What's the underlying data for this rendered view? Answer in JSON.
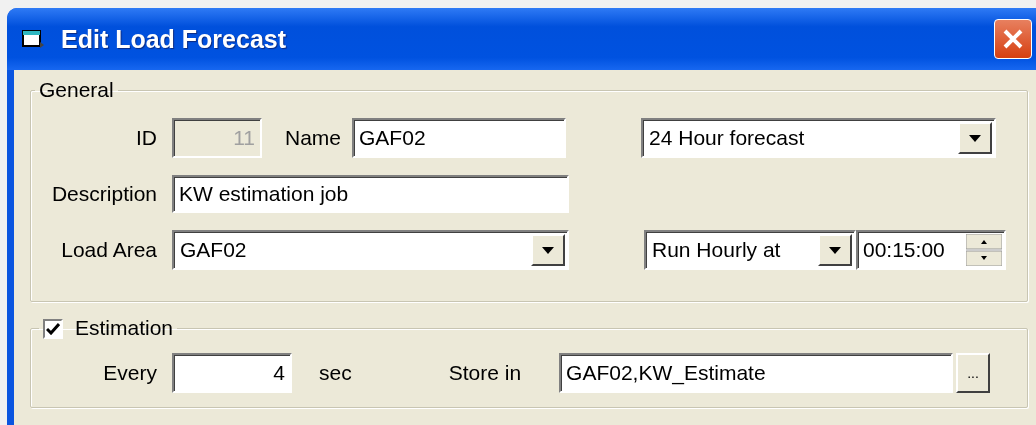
{
  "window": {
    "title": "Edit Load Forecast"
  },
  "general": {
    "legend": "General",
    "id": {
      "label": "ID",
      "value": "11",
      "disabled": true
    },
    "name": {
      "label": "Name",
      "value": "GAF02"
    },
    "forecast_type": {
      "value": "24 Hour forecast"
    },
    "description": {
      "label": "Description",
      "value": "KW estimation job"
    },
    "load_area": {
      "label": "Load Area",
      "value": "GAF02"
    },
    "schedule": {
      "value": "Run Hourly at"
    },
    "time": {
      "value": "00:15:00"
    }
  },
  "estimation": {
    "label": "Estimation",
    "checked": true,
    "every": {
      "label": "Every",
      "value": "4",
      "unit": "sec"
    },
    "store_in": {
      "label": "Store in",
      "value": "GAF02,KW_Estimate"
    },
    "browse_button": "..."
  }
}
